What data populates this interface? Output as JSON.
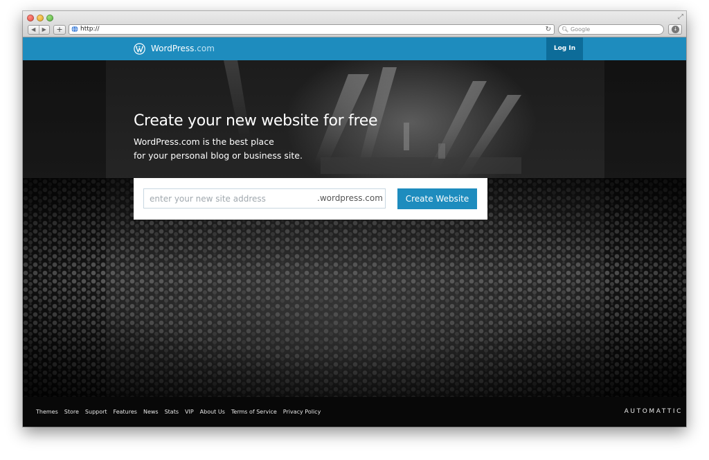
{
  "browser": {
    "url": "http://",
    "search_placeholder": "Google"
  },
  "masterbar": {
    "brand_name": "WordPress",
    "brand_suffix": ".com",
    "login_label": "Log In",
    "color": "#1e8cbe"
  },
  "hero": {
    "headline": "Create your new website for free",
    "subline_1": "WordPress.com is the best place",
    "subline_2": "for your personal blog or business site.",
    "site_placeholder": "enter your new site address",
    "domain_suffix": ".wordpress.com",
    "cta_label": "Create Website"
  },
  "footer": {
    "links": [
      "Themes",
      "Store",
      "Support",
      "Features",
      "News",
      "Stats",
      "VIP",
      "About Us",
      "Terms of Service",
      "Privacy Policy"
    ],
    "company": "AUTOMATTIC"
  },
  "icons": [
    "close-icon",
    "minimize-icon",
    "zoom-icon",
    "back-icon",
    "forward-icon",
    "add-icon",
    "globe-icon",
    "reload-icon",
    "search-icon",
    "downloads-icon",
    "wordpress-logo-icon",
    "resize-icon"
  ]
}
